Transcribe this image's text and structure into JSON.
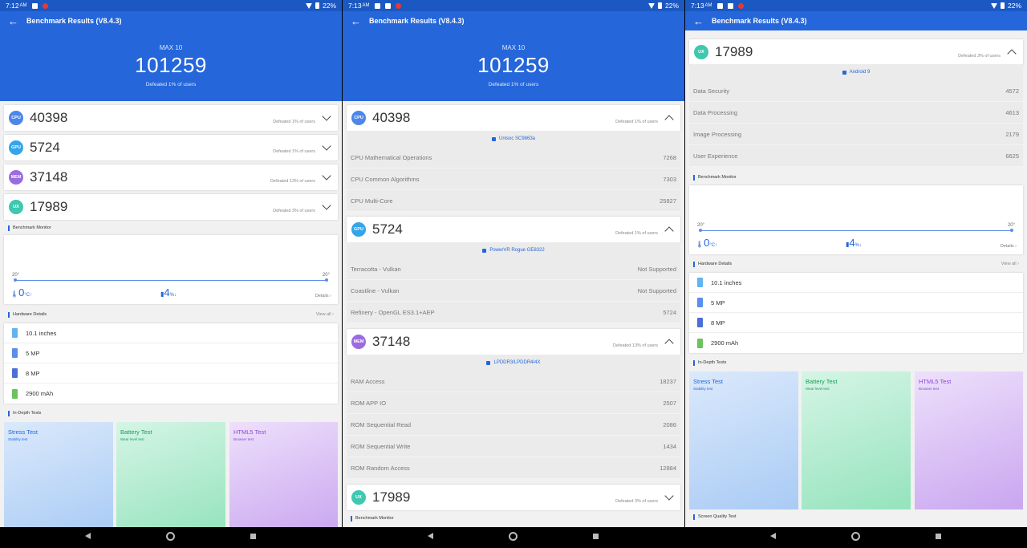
{
  "statusbar": {
    "time1": "7:12",
    "ampm": "AM",
    "time2": "7:13",
    "battery": "22%"
  },
  "appbar": {
    "title": "Benchmark Results (V8.4.3)"
  },
  "hero": {
    "device": "MAX 10",
    "total": "101259",
    "defeated": "Defeated 1% of users"
  },
  "scores": {
    "cpu": {
      "badge": "CPU",
      "value": "40398",
      "defeated": "Defeated 1% of users"
    },
    "gpu": {
      "badge": "GPU",
      "value": "5724",
      "defeated": "Defeated 1% of users"
    },
    "mem": {
      "badge": "MEM",
      "value": "37148",
      "defeated": "Defeated 13% of users"
    },
    "ux": {
      "badge": "UX",
      "value": "17989",
      "defeated": "Defeated 3% of users"
    }
  },
  "benchmark_monitor": {
    "title": "Benchmark Monitor",
    "temp_left": "20°",
    "temp_right": "20°",
    "temp_rise": "0",
    "temp_unit": "°C↑",
    "battery_drop": "4",
    "battery_unit": "%↓",
    "details": "Details"
  },
  "hardware": {
    "title": "Hardware Details",
    "view_all": "View all",
    "items": [
      "10.1 inches",
      "5 MP",
      "8 MP",
      "2900 mAh"
    ]
  },
  "in_depth": {
    "title": "In-Depth Tests",
    "tiles": [
      {
        "title": "Stress Test",
        "sub": "Stability test"
      },
      {
        "title": "Battery Test",
        "sub": "Wear level test"
      },
      {
        "title": "HTML5 Test",
        "sub": "Browser test"
      }
    ]
  },
  "cpu_detail": {
    "chip": "Unisoc SC9863a",
    "rows": [
      {
        "label": "CPU Mathematical Operations",
        "value": "7268"
      },
      {
        "label": "CPU Common Algorithms",
        "value": "7303"
      },
      {
        "label": "CPU Multi-Core",
        "value": "25827"
      }
    ]
  },
  "gpu_detail": {
    "chip": "PowerVR Rogue GE8322",
    "rows": [
      {
        "label": "Terracotta - Vulkan",
        "value": "Not Supported"
      },
      {
        "label": "Coastline - Vulkan",
        "value": "Not Supported"
      },
      {
        "label": "Refinery - OpenGL ES3.1+AEP",
        "value": "5724"
      }
    ]
  },
  "mem_detail": {
    "chip": "LPDDR3/LPDDR4/4X",
    "rows": [
      {
        "label": "RAM Access",
        "value": "18237"
      },
      {
        "label": "ROM APP IO",
        "value": "2507"
      },
      {
        "label": "ROM Sequential Read",
        "value": "2086"
      },
      {
        "label": "ROM Sequential Write",
        "value": "1434"
      },
      {
        "label": "ROM Random Access",
        "value": "12884"
      }
    ]
  },
  "ux_detail": {
    "os": "Android 9",
    "rows": [
      {
        "label": "Data Security",
        "value": "4572"
      },
      {
        "label": "Data Processing",
        "value": "4613"
      },
      {
        "label": "Image Processing",
        "value": "2179"
      },
      {
        "label": "User Experience",
        "value": "6625"
      }
    ]
  },
  "screen_quality": "Screen Quality Test"
}
